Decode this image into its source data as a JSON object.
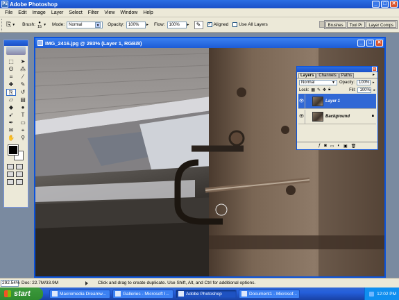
{
  "app": {
    "title": "Adobe Photoshop"
  },
  "window_buttons": {
    "minimize": "_",
    "maximize": "□",
    "close": "✕"
  },
  "menu": [
    "File",
    "Edit",
    "Image",
    "Layer",
    "Select",
    "Filter",
    "View",
    "Window",
    "Help"
  ],
  "options": {
    "brush_label": "Brush:",
    "brush_size": "15",
    "mode_label": "Mode:",
    "mode_value": "Normal",
    "opacity_label": "Opacity:",
    "opacity_value": "100%",
    "flow_label": "Flow:",
    "flow_value": "100%",
    "aligned_label": "Aligned",
    "aligned_checked": true,
    "use_all_layers_label": "Use All Layers",
    "use_all_layers_checked": false,
    "palette_well": [
      "Brushes",
      "Tool Pr",
      "Layer Comps"
    ]
  },
  "document": {
    "title": "IMG_2416.jpg @ 293% (Layer 1, RGB/8)"
  },
  "layers_panel": {
    "tabs": [
      "Layers",
      "Channels",
      "Paths"
    ],
    "active_tab": "Layers",
    "blend_mode": "Normal",
    "opacity_label": "Opacity:",
    "opacity_value": "100%",
    "lock_label": "Lock:",
    "fill_label": "Fill:",
    "fill_value": "100%",
    "layers": [
      {
        "name": "Layer 1",
        "selected": true
      },
      {
        "name": "Background",
        "selected": false
      }
    ]
  },
  "status": {
    "zoom": "292.54%",
    "doc": "Doc: 22.7M/33.9M",
    "tip": "Click and drag to create duplicate.  Use Shift, Alt, and Ctrl for additional options."
  },
  "taskbar": {
    "start_label": "start",
    "tasks": [
      {
        "label": "Macromedia Dreamw...",
        "active": false
      },
      {
        "label": "Galleries - Microsoft I...",
        "active": false
      },
      {
        "label": "Adobe Photoshop",
        "active": true
      },
      {
        "label": "Document1 - Microsof...",
        "active": false
      }
    ],
    "clock": "12:02 PM"
  },
  "colors": {
    "titlebar": "#1a50c8",
    "chrome": "#ece9d8",
    "selection": "#3168d5",
    "foreground_color": "#000000",
    "background_color": "#ffffff"
  }
}
